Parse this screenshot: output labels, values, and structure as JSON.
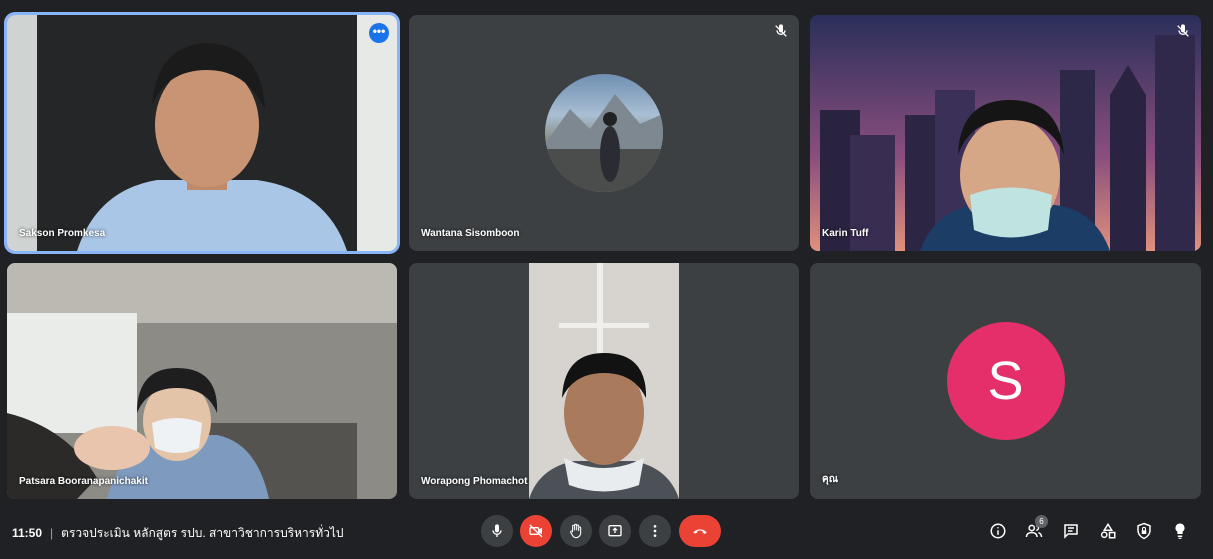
{
  "participants": [
    {
      "name": "Sakson Promkesa",
      "more_label": "•••"
    },
    {
      "name": "Wantana Sisomboon"
    },
    {
      "name": "Karin Tuff"
    },
    {
      "name": "Patsara Booranapanichakit"
    },
    {
      "name": "Worapong Phomachot"
    },
    {
      "name": "คุณ",
      "initial": "S"
    }
  ],
  "meeting": {
    "time": "11:50",
    "separator": "|",
    "title": "ตรวจประเมิน หลักสูตร รปบ. สาขาวิชาการบริหารทั่วไป"
  },
  "toolbar": {
    "participants_count": "6"
  },
  "colors": {
    "background": "#202124",
    "tile": "#3c4043",
    "active_border": "#8ab4f8",
    "hangup": "#ea4335",
    "avatar_s": "#e52f6a"
  },
  "icons": [
    "microphone-icon",
    "camera-off-icon",
    "raise-hand-icon",
    "present-screen-icon",
    "more-options-icon",
    "hang-up-icon",
    "info-icon",
    "people-icon",
    "chat-icon",
    "activities-icon",
    "host-controls-icon",
    "mic-muted-icon"
  ]
}
